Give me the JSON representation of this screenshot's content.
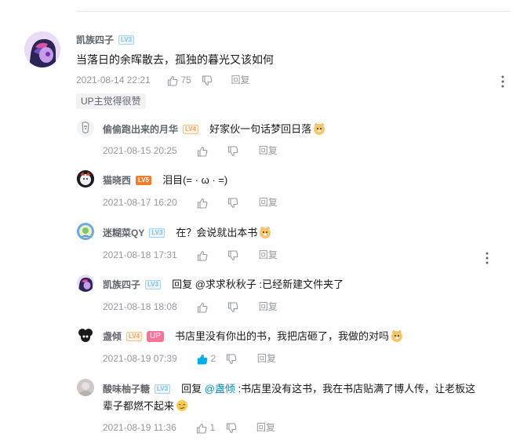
{
  "root": {
    "username": "凯族四子",
    "level": "LV3",
    "content": "当落日的余晖散去，孤独的暮光又该如何",
    "time": "2021-08-14 22:21",
    "likes": "75",
    "reply_label": "回复",
    "tag": "UP主觉得很赞"
  },
  "replies": [
    {
      "username": "偷偷跑出来的月华",
      "level": "LV4",
      "content": "好家伙一句话梦回日落",
      "time": "2021-08-15 20:25",
      "likes": "",
      "reply_label": "回复"
    },
    {
      "username": "猫晓西",
      "level": "LV5",
      "content": "泪目(= · ω · =)",
      "time": "2021-08-17 16:20",
      "likes": "",
      "reply_label": "回复"
    },
    {
      "username": "迷糊菜QY",
      "level": "LV3",
      "content": "在？会说就出本书",
      "time": "2021-08-18 17:31",
      "likes": "",
      "reply_label": "回复"
    },
    {
      "username": "凯族四子",
      "level": "LV3",
      "reply_prefix": "回复 @求求秋秋子 :",
      "content": "已经新建文件夹了",
      "time": "2021-08-18 18:08",
      "likes": "",
      "reply_label": "回复"
    },
    {
      "username": "盏倾",
      "level": "LV4",
      "up_badge": "UP",
      "content": "书店里没有你出的书，我把店砸了，我做的对吗",
      "time": "2021-08-19 07:39",
      "likes": "2",
      "reply_label": "回复"
    },
    {
      "username": "酸味柚子糖",
      "level": "LV3",
      "reply_prefix": "回复 ",
      "mention": "@盏倾",
      "content_line1": " :书店里没有这书，我在书店贴满了博人传，让老板这",
      "content_line2": "辈子都燃不起来",
      "time": "2021-08-19 11:36",
      "likes": "1",
      "reply_label": "回复"
    }
  ],
  "colors": {
    "accent": "#00aeec",
    "pink": "#fb7299",
    "meta": "#9499a0"
  }
}
